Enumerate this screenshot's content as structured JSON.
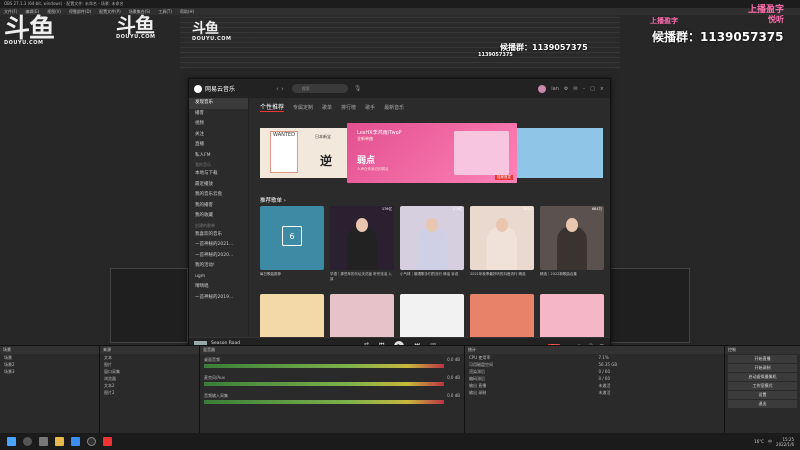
{
  "obs": {
    "title": "OBS 27.1.3 (64-bit, windows) - 配置文件: 未命名 - 场景: 未命名",
    "menu": [
      "文件(F)",
      "编辑(E)",
      "视图(V)",
      "停靠部件(D)",
      "配置文件(P)",
      "场景集合(S)",
      "工具(T)",
      "帮助(H)"
    ]
  },
  "overlay": {
    "logo_big": "斗鱼",
    "logo_small": "DOUYU.COM",
    "group_label": "候播群：1139057375",
    "group_label_small": "候播群：1139057375",
    "group_label_top": "1139057375",
    "pink_text_1": "上播盈字",
    "pink_text_2": "悦听"
  },
  "music": {
    "app_name": "网易云音乐",
    "search_placeholder": "搜索",
    "user_name": "ian",
    "sidebar": {
      "items_top": [
        "发现音乐",
        "播客",
        "视频",
        "关注",
        "直播",
        "私人FM"
      ],
      "section_my": "我的音乐",
      "items_my": [
        "本地与下载",
        "最近播放",
        "我的音乐云盘",
        "我的播客",
        "我的收藏"
      ],
      "section_playlist": "创建的歌单",
      "items_playlist": [
        "我喜欢的音乐",
        "一首神秘的2021...",
        "一首神秘的2020...",
        "我的活动!",
        "ugm",
        "晴晴唱",
        "一首神秘的2019..."
      ]
    },
    "tabs": [
      "个性推荐",
      "专属定制",
      "歌单",
      "排行榜",
      "歌手",
      "最新音乐"
    ],
    "banner": {
      "title": "LesHX李鸿雨/TwoP",
      "subtitle": "全新单曲",
      "song": "弱点",
      "artist": "人声在你身边的弱点",
      "badge": "独家首发",
      "left_header": "WANTED",
      "left_jp": "日本新宝",
      "left_big": "逆"
    },
    "section_title": "推荐歌单 ›",
    "playlists": [
      {
        "caption": "每日歌曲推荐",
        "plays": "",
        "cal_day": "6"
      },
      {
        "caption": "华语｜那些年的乐坛天花板 听完流泪 入耳",
        "plays": "176亿"
      },
      {
        "caption": "小气球｜敢唱歌手们的流行 情话 诉说",
        "plays": "1.3亿"
      },
      {
        "caption": "2021年秋季最好听的抖音流行 精选",
        "plays": "2012"
      },
      {
        "caption": "精选｜2022新歌曲合集",
        "plays": "684万"
      },
      {
        "caption": "",
        "plays": ""
      },
      {
        "caption": "",
        "plays": ""
      },
      {
        "caption": "",
        "plays": ""
      },
      {
        "caption": "",
        "plays": ""
      },
      {
        "caption": "",
        "plays": ""
      }
    ],
    "player": {
      "song": "Season Road",
      "artist": "艾米 / TIMA",
      "progress": 0.18,
      "hd_label": "标准"
    }
  },
  "dock": {
    "scenes_head": "场景",
    "scenes": [
      "场景",
      "场景2",
      "场景3"
    ],
    "sources_head": "来源",
    "sources": [
      "文本",
      "图片",
      "窗口采集",
      "浏览器",
      "文本2",
      "图片2"
    ],
    "mixer_head": "混音器",
    "mixer_tracks": [
      "桌面音频",
      "麦克风/Aux",
      "音频输入采集"
    ],
    "mixer_db": [
      "0.0 dB",
      "0.0 dB",
      "0.0 dB"
    ],
    "stats_head": "统计",
    "stats": [
      "CPU 使用率",
      "可用磁盘空间",
      "渲染滞后",
      "编码滞后",
      "输出 直播",
      "输出 录制"
    ],
    "stats_vals": [
      "7.1%",
      "56.35 GB",
      "0 / 60",
      "0 / 60",
      "未激活",
      "未激活"
    ],
    "controls_head": "控制",
    "controls": [
      "开始直播",
      "开始录制",
      "启动虚拟摄像机",
      "工作室模式",
      "设置",
      "退出"
    ]
  },
  "taskbar": {
    "clock": "15:25",
    "date": "2022/1/6",
    "temp": "16°C",
    "lang": "中"
  }
}
